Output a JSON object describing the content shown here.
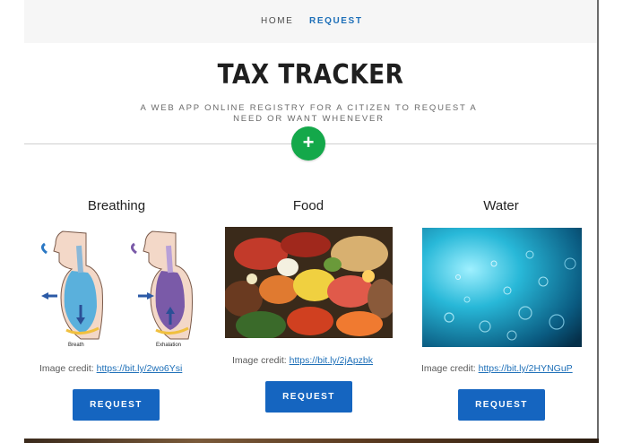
{
  "nav": {
    "items": [
      {
        "label": "HOME"
      },
      {
        "label": "REQUEST",
        "active": true
      }
    ]
  },
  "hero": {
    "title": "TAX TRACKER",
    "subtitle": "A WEB APP ONLINE REGISTRY FOR A CITIZEN TO REQUEST A NEED OR WANT WHENEVER",
    "add_button": "+"
  },
  "cards": [
    {
      "title": "Breathing",
      "image": {
        "icon": "breathing-diagram",
        "captions": [
          "Breath",
          "Exhalation"
        ]
      },
      "credit_label": "Image credit:",
      "credit_link": "https://bit.ly/2wo6Ysi",
      "button": "REQUEST"
    },
    {
      "title": "Food",
      "image": {
        "icon": "food-photo"
      },
      "credit_label": "Image credit:",
      "credit_link": "https://bit.ly/2jApzbk",
      "button": "REQUEST"
    },
    {
      "title": "Water",
      "image": {
        "icon": "water-bubbles-photo"
      },
      "credit_label": "Image credit:",
      "credit_link": "https://bit.ly/2HYNGuP",
      "button": "REQUEST"
    }
  ],
  "colors": {
    "accent": "#1d6fb8",
    "button": "#1565c0",
    "add_button": "#14a84a"
  }
}
